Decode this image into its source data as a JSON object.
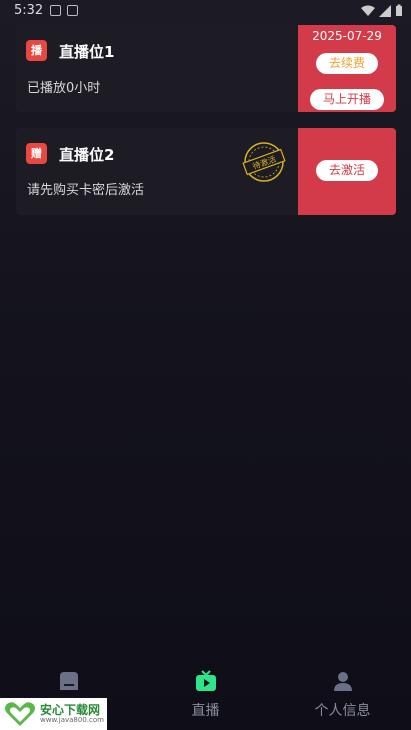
{
  "status_bar": {
    "time": "5:32"
  },
  "cards": [
    {
      "badge": "播",
      "title": "直播位1",
      "subtitle": "已播放0小时",
      "date": "2025-07-29",
      "renew_label": "去续费",
      "start_label": "马上开播"
    },
    {
      "badge": "赠",
      "title": "直播位2",
      "subtitle": "请先购买卡密后激活",
      "stamp_text": "待激活",
      "activate_label": "去激活"
    }
  ],
  "tabbar": {
    "items": [
      {
        "label": "",
        "icon": "home-icon"
      },
      {
        "label": "直播",
        "icon": "tv-play-icon"
      },
      {
        "label": "个人信息",
        "icon": "person-icon"
      }
    ]
  },
  "watermark": {
    "name": "安心下载网",
    "url": "www.java800.com"
  },
  "colors": {
    "accent_red": "#d33b4b",
    "badge_red": "#e8483f",
    "renew_orange": "#f0a12c",
    "live_green": "#2ee58b"
  }
}
